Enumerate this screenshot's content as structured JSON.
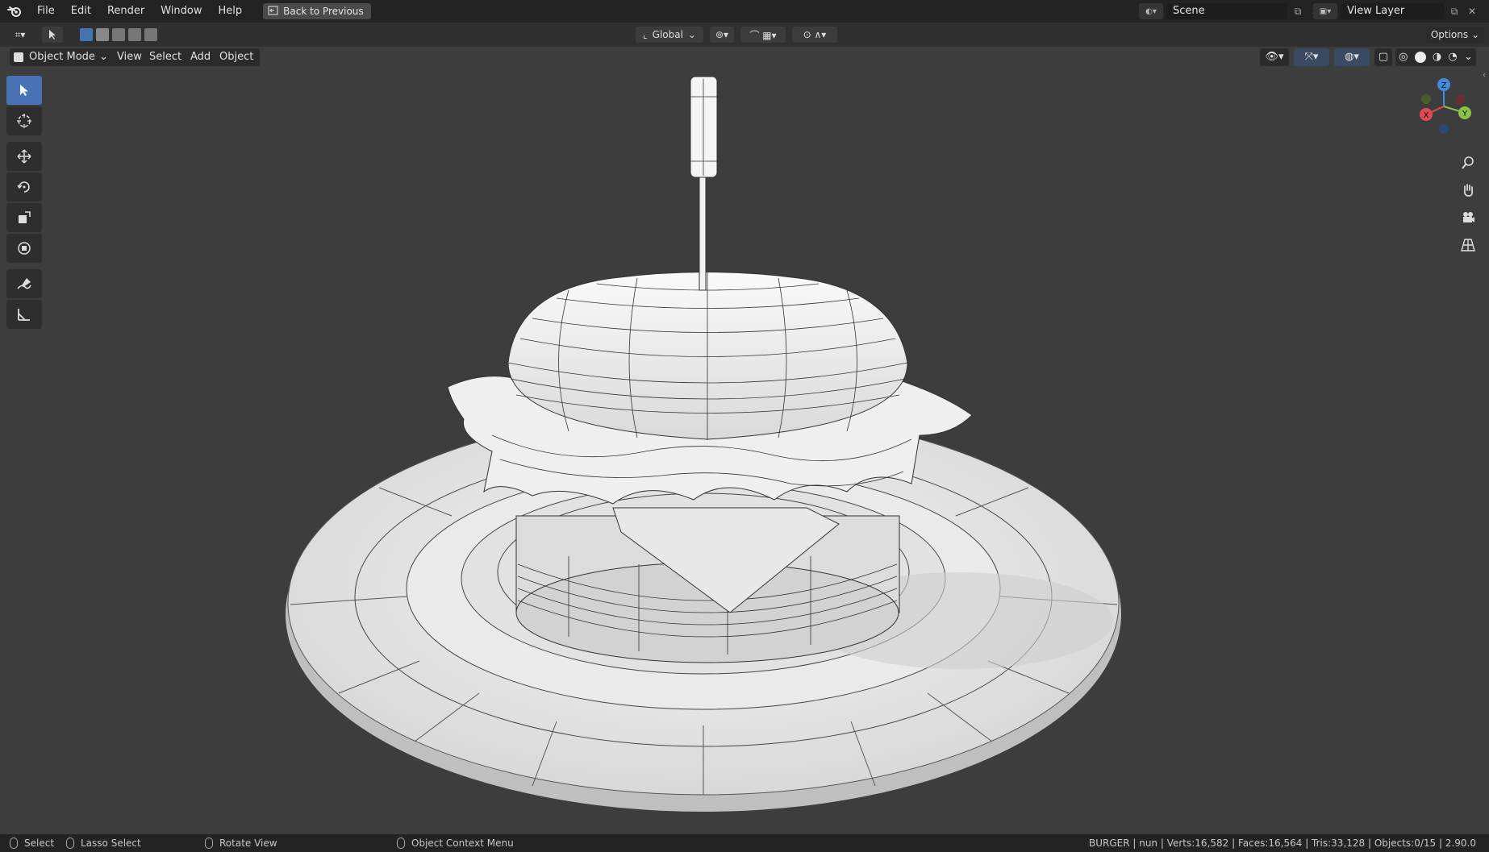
{
  "topbar": {
    "menus": [
      "File",
      "Edit",
      "Render",
      "Window",
      "Help"
    ],
    "back_button": "Back to Previous",
    "scene_name": "Scene",
    "view_layer_name": "View Layer"
  },
  "toolheader": {
    "transform_orientation": "Global",
    "options_label": "Options"
  },
  "viewport_header": {
    "mode": "Object Mode",
    "menus": [
      "View",
      "Select",
      "Add",
      "Object"
    ]
  },
  "gizmo": {
    "x": "X",
    "y": "Y",
    "z": "Z"
  },
  "statusbar": {
    "select": "Select",
    "lasso": "Lasso Select",
    "rotate": "Rotate View",
    "context": "Object Context Menu",
    "stats": "BURGER | nun | Verts:16,582 | Faces:16,564 | Tris:33,128 | Objects:0/15 | 2.90.0"
  },
  "colors": {
    "accent": "#4772b3",
    "axis_x": "#e04a58",
    "axis_y": "#8bc34a",
    "axis_z": "#3f8bdc"
  }
}
